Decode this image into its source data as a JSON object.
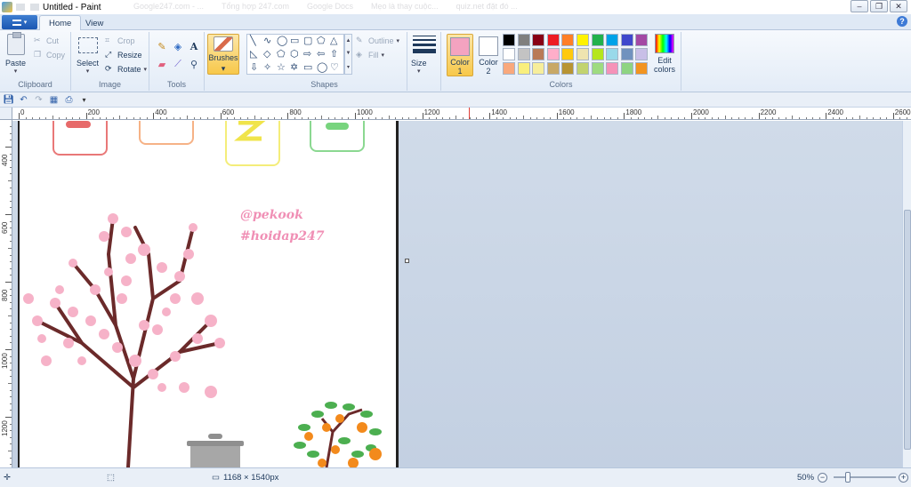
{
  "window": {
    "title": "Untitled - Paint",
    "background_tabs": [
      "Google247.com - ...",
      "Tổng hợp 247.com",
      "Google Docs",
      "Mẹo là thay cuộc...",
      "quiz.net đặt đó ..."
    ]
  },
  "tabs": [
    {
      "label": "Home",
      "active": true
    },
    {
      "label": "View",
      "active": false
    }
  ],
  "ribbon": {
    "clipboard": {
      "group": "Clipboard",
      "paste": "Paste",
      "cut": "Cut",
      "copy": "Copy"
    },
    "image": {
      "group": "Image",
      "select": "Select",
      "crop": "Crop",
      "resize": "Resize",
      "rotate": "Rotate"
    },
    "tools": {
      "group": "Tools"
    },
    "brushes": {
      "label": "Brushes"
    },
    "shapes": {
      "group": "Shapes",
      "outline": "Outline",
      "fill": "Fill"
    },
    "size": {
      "label": "Size"
    },
    "colors": {
      "group": "Colors",
      "color1": "Color 1",
      "color1_line1": "Color",
      "color1_line2": "1",
      "color1_value": "#f4a3c0",
      "color2_line1": "Color",
      "color2_line2": "2",
      "color2_value": "#ffffff",
      "edit_line1": "Edit",
      "edit_line2": "colors",
      "palette_row1": [
        "#000000",
        "#7f7f7f",
        "#880015",
        "#ed1c24",
        "#ff7f27",
        "#fff200",
        "#22b14c",
        "#00a2e8",
        "#3f48cc",
        "#a349a4"
      ],
      "palette_row2": [
        "#ffffff",
        "#c3c3c3",
        "#b97a57",
        "#ffaec9",
        "#ffc90e",
        "#efe4b0",
        "#b5e61d",
        "#99d9ea",
        "#7092be",
        "#c8bfe7"
      ],
      "palette_row3": [
        "#f9a87c",
        "#f9ef7d",
        "#f7ee9b",
        "#c8a866",
        "#b89433",
        "#c2d36f",
        "#9edb80",
        "#f592b8",
        "#8ed482",
        "#f29420"
      ]
    }
  },
  "ruler": {
    "top": [
      "0",
      "200",
      "400",
      "600",
      "800",
      "1000",
      "1200",
      "1400",
      "1600",
      "1800",
      "2000",
      "2200",
      "2400",
      "2600"
    ],
    "left": [
      "400",
      "600",
      "800",
      "1000",
      "1200"
    ]
  },
  "canvas": {
    "watermark_line1": "@pekook",
    "watermark_line2": "#hoidap247"
  },
  "status": {
    "dimensions": "1168 × 1540px",
    "zoom": "50%"
  },
  "colors": {
    "accent": "#1a56b2",
    "workspace": "#c8d4e5",
    "selected": "#f7c84a"
  }
}
